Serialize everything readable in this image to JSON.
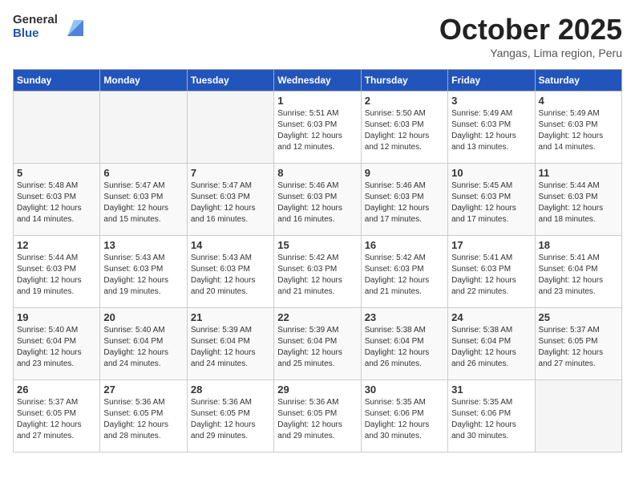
{
  "header": {
    "logo_general": "General",
    "logo_blue": "Blue",
    "month_title": "October 2025",
    "location": "Yangas, Lima region, Peru"
  },
  "days_of_week": [
    "Sunday",
    "Monday",
    "Tuesday",
    "Wednesday",
    "Thursday",
    "Friday",
    "Saturday"
  ],
  "weeks": [
    [
      {
        "day": "",
        "info": ""
      },
      {
        "day": "",
        "info": ""
      },
      {
        "day": "",
        "info": ""
      },
      {
        "day": "1",
        "info": "Sunrise: 5:51 AM\nSunset: 6:03 PM\nDaylight: 12 hours\nand 12 minutes."
      },
      {
        "day": "2",
        "info": "Sunrise: 5:50 AM\nSunset: 6:03 PM\nDaylight: 12 hours\nand 12 minutes."
      },
      {
        "day": "3",
        "info": "Sunrise: 5:49 AM\nSunset: 6:03 PM\nDaylight: 12 hours\nand 13 minutes."
      },
      {
        "day": "4",
        "info": "Sunrise: 5:49 AM\nSunset: 6:03 PM\nDaylight: 12 hours\nand 14 minutes."
      }
    ],
    [
      {
        "day": "5",
        "info": "Sunrise: 5:48 AM\nSunset: 6:03 PM\nDaylight: 12 hours\nand 14 minutes."
      },
      {
        "day": "6",
        "info": "Sunrise: 5:47 AM\nSunset: 6:03 PM\nDaylight: 12 hours\nand 15 minutes."
      },
      {
        "day": "7",
        "info": "Sunrise: 5:47 AM\nSunset: 6:03 PM\nDaylight: 12 hours\nand 16 minutes."
      },
      {
        "day": "8",
        "info": "Sunrise: 5:46 AM\nSunset: 6:03 PM\nDaylight: 12 hours\nand 16 minutes."
      },
      {
        "day": "9",
        "info": "Sunrise: 5:46 AM\nSunset: 6:03 PM\nDaylight: 12 hours\nand 17 minutes."
      },
      {
        "day": "10",
        "info": "Sunrise: 5:45 AM\nSunset: 6:03 PM\nDaylight: 12 hours\nand 17 minutes."
      },
      {
        "day": "11",
        "info": "Sunrise: 5:44 AM\nSunset: 6:03 PM\nDaylight: 12 hours\nand 18 minutes."
      }
    ],
    [
      {
        "day": "12",
        "info": "Sunrise: 5:44 AM\nSunset: 6:03 PM\nDaylight: 12 hours\nand 19 minutes."
      },
      {
        "day": "13",
        "info": "Sunrise: 5:43 AM\nSunset: 6:03 PM\nDaylight: 12 hours\nand 19 minutes."
      },
      {
        "day": "14",
        "info": "Sunrise: 5:43 AM\nSunset: 6:03 PM\nDaylight: 12 hours\nand 20 minutes."
      },
      {
        "day": "15",
        "info": "Sunrise: 5:42 AM\nSunset: 6:03 PM\nDaylight: 12 hours\nand 21 minutes."
      },
      {
        "day": "16",
        "info": "Sunrise: 5:42 AM\nSunset: 6:03 PM\nDaylight: 12 hours\nand 21 minutes."
      },
      {
        "day": "17",
        "info": "Sunrise: 5:41 AM\nSunset: 6:03 PM\nDaylight: 12 hours\nand 22 minutes."
      },
      {
        "day": "18",
        "info": "Sunrise: 5:41 AM\nSunset: 6:04 PM\nDaylight: 12 hours\nand 23 minutes."
      }
    ],
    [
      {
        "day": "19",
        "info": "Sunrise: 5:40 AM\nSunset: 6:04 PM\nDaylight: 12 hours\nand 23 minutes."
      },
      {
        "day": "20",
        "info": "Sunrise: 5:40 AM\nSunset: 6:04 PM\nDaylight: 12 hours\nand 24 minutes."
      },
      {
        "day": "21",
        "info": "Sunrise: 5:39 AM\nSunset: 6:04 PM\nDaylight: 12 hours\nand 24 minutes."
      },
      {
        "day": "22",
        "info": "Sunrise: 5:39 AM\nSunset: 6:04 PM\nDaylight: 12 hours\nand 25 minutes."
      },
      {
        "day": "23",
        "info": "Sunrise: 5:38 AM\nSunset: 6:04 PM\nDaylight: 12 hours\nand 26 minutes."
      },
      {
        "day": "24",
        "info": "Sunrise: 5:38 AM\nSunset: 6:04 PM\nDaylight: 12 hours\nand 26 minutes."
      },
      {
        "day": "25",
        "info": "Sunrise: 5:37 AM\nSunset: 6:05 PM\nDaylight: 12 hours\nand 27 minutes."
      }
    ],
    [
      {
        "day": "26",
        "info": "Sunrise: 5:37 AM\nSunset: 6:05 PM\nDaylight: 12 hours\nand 27 minutes."
      },
      {
        "day": "27",
        "info": "Sunrise: 5:36 AM\nSunset: 6:05 PM\nDaylight: 12 hours\nand 28 minutes."
      },
      {
        "day": "28",
        "info": "Sunrise: 5:36 AM\nSunset: 6:05 PM\nDaylight: 12 hours\nand 29 minutes."
      },
      {
        "day": "29",
        "info": "Sunrise: 5:36 AM\nSunset: 6:05 PM\nDaylight: 12 hours\nand 29 minutes."
      },
      {
        "day": "30",
        "info": "Sunrise: 5:35 AM\nSunset: 6:06 PM\nDaylight: 12 hours\nand 30 minutes."
      },
      {
        "day": "31",
        "info": "Sunrise: 5:35 AM\nSunset: 6:06 PM\nDaylight: 12 hours\nand 30 minutes."
      },
      {
        "day": "",
        "info": ""
      }
    ]
  ]
}
